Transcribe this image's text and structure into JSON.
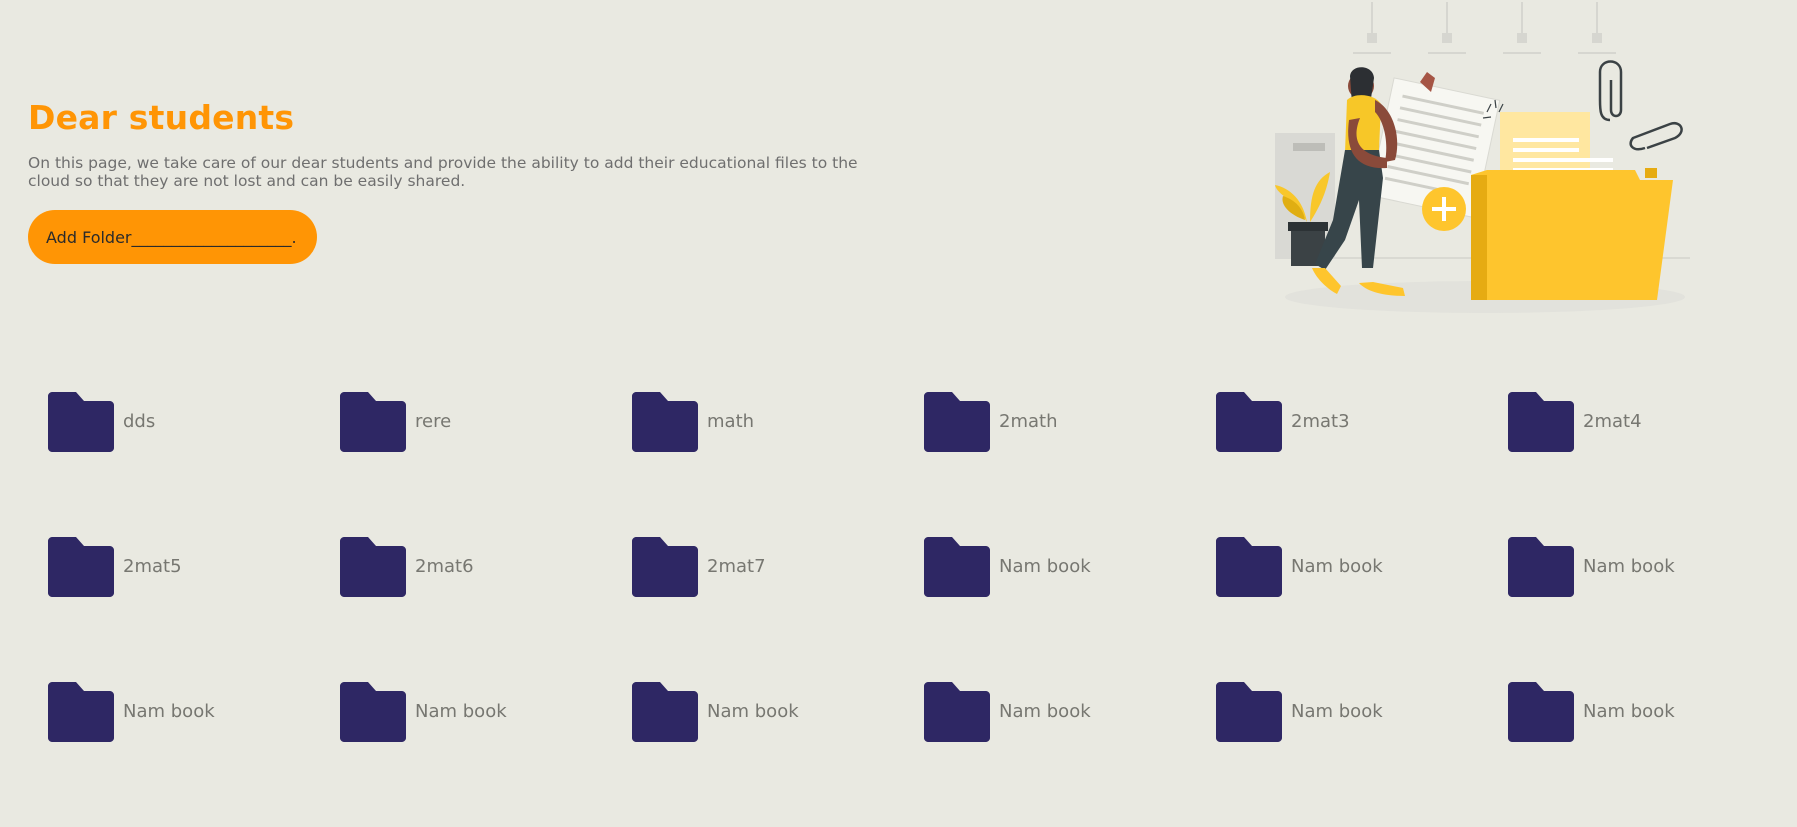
{
  "hero": {
    "title": "Dear students",
    "description": "On this page, we take care of our dear students and provide the ability to add their educational files to the cloud so that they are not lost and can be easily shared.",
    "add_folder_label": "Add Folder____________________."
  },
  "colors": {
    "accent": "#ff9505",
    "folder": "#2e2764",
    "background": "#e9e9e1",
    "text_muted": "#777771"
  },
  "illustration": {
    "icon": "student-carrying-files-illustration"
  },
  "folders": [
    {
      "name": "dds"
    },
    {
      "name": "rere"
    },
    {
      "name": "math"
    },
    {
      "name": "2math"
    },
    {
      "name": "2mat3"
    },
    {
      "name": "2mat4"
    },
    {
      "name": "2mat5"
    },
    {
      "name": "2mat6"
    },
    {
      "name": "2mat7"
    },
    {
      "name": "Nam book"
    },
    {
      "name": "Nam book"
    },
    {
      "name": "Nam book"
    },
    {
      "name": "Nam book"
    },
    {
      "name": "Nam book"
    },
    {
      "name": "Nam book"
    },
    {
      "name": "Nam book"
    },
    {
      "name": "Nam book"
    },
    {
      "name": "Nam book"
    }
  ]
}
